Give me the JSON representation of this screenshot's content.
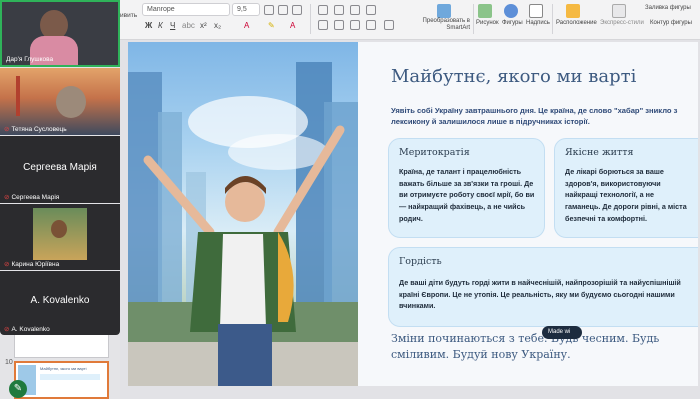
{
  "ribbon": {
    "cut_label": "ивить",
    "font_name": "Manrope",
    "font_size": "9,5",
    "smartart_label": "Преобразовать в SmartArt",
    "picture_label": "Рисунок",
    "shapes_label": "Фигуры",
    "textbox_label": "Надпись",
    "arrange_label": "Расположение",
    "quick_styles_label": "Экспресс-стили",
    "shape_fill_label": "Заливка фигуры",
    "shape_outline_label": "Контур фигуры"
  },
  "participants": [
    {
      "name": "Дар'я Глушкова",
      "muted": false
    },
    {
      "name": "Тетяна Сусловець",
      "muted": true
    },
    {
      "name": "Сергеева Марія",
      "muted": true,
      "display": "Сергеева Марія"
    },
    {
      "name": "Карина Юріївна",
      "muted": true
    },
    {
      "name": "A. Kovalenko",
      "muted": true,
      "display": "A. Kovalenko"
    }
  ],
  "thumbnails": {
    "selected_number": "10",
    "next_preview_title": "Майбутнє, якого ми варті"
  },
  "slide": {
    "title": "Майбутнє, якого ми варті",
    "intro": "Уявіть собі Україну завтрашнього дня. Це країна, де слово \"хабар\" зникло з лексикону й залишилося лише в підручниках історії.",
    "cards": [
      {
        "title": "Меритократія",
        "text": "Країна, де талант і працелюбність важать більше за зв'язки та гроші. Де ви отримуєте роботу своєї мрії, бо ви — найкращий фахівець, а не чийсь родич."
      },
      {
        "title": "Якісне життя",
        "text": "Де лікарі борються за ваше здоров'я, використовуючи найкращі технології, а не гаманець. Де дороги рівні, а міста безпечні та комфортні."
      },
      {
        "title": "Гордість",
        "text": "Де ваші діти будуть горді жити в найчеснішій, найпрозорішій та найуспішнішій країні Європи. Це не утопія. Це реальність, яку ми будуємо сьогодні нашими вчинками."
      }
    ],
    "footer": "Зміни починаються з тебе. Будь чесним. Будь сміливим. Будуй нову Україну.",
    "badge": "Made wi"
  },
  "colors": {
    "accent_title": "#3d5a80",
    "card_bg": "#dff0fb",
    "thumb_selected": "#e07a3a",
    "active_speaker": "#2fb35a"
  }
}
